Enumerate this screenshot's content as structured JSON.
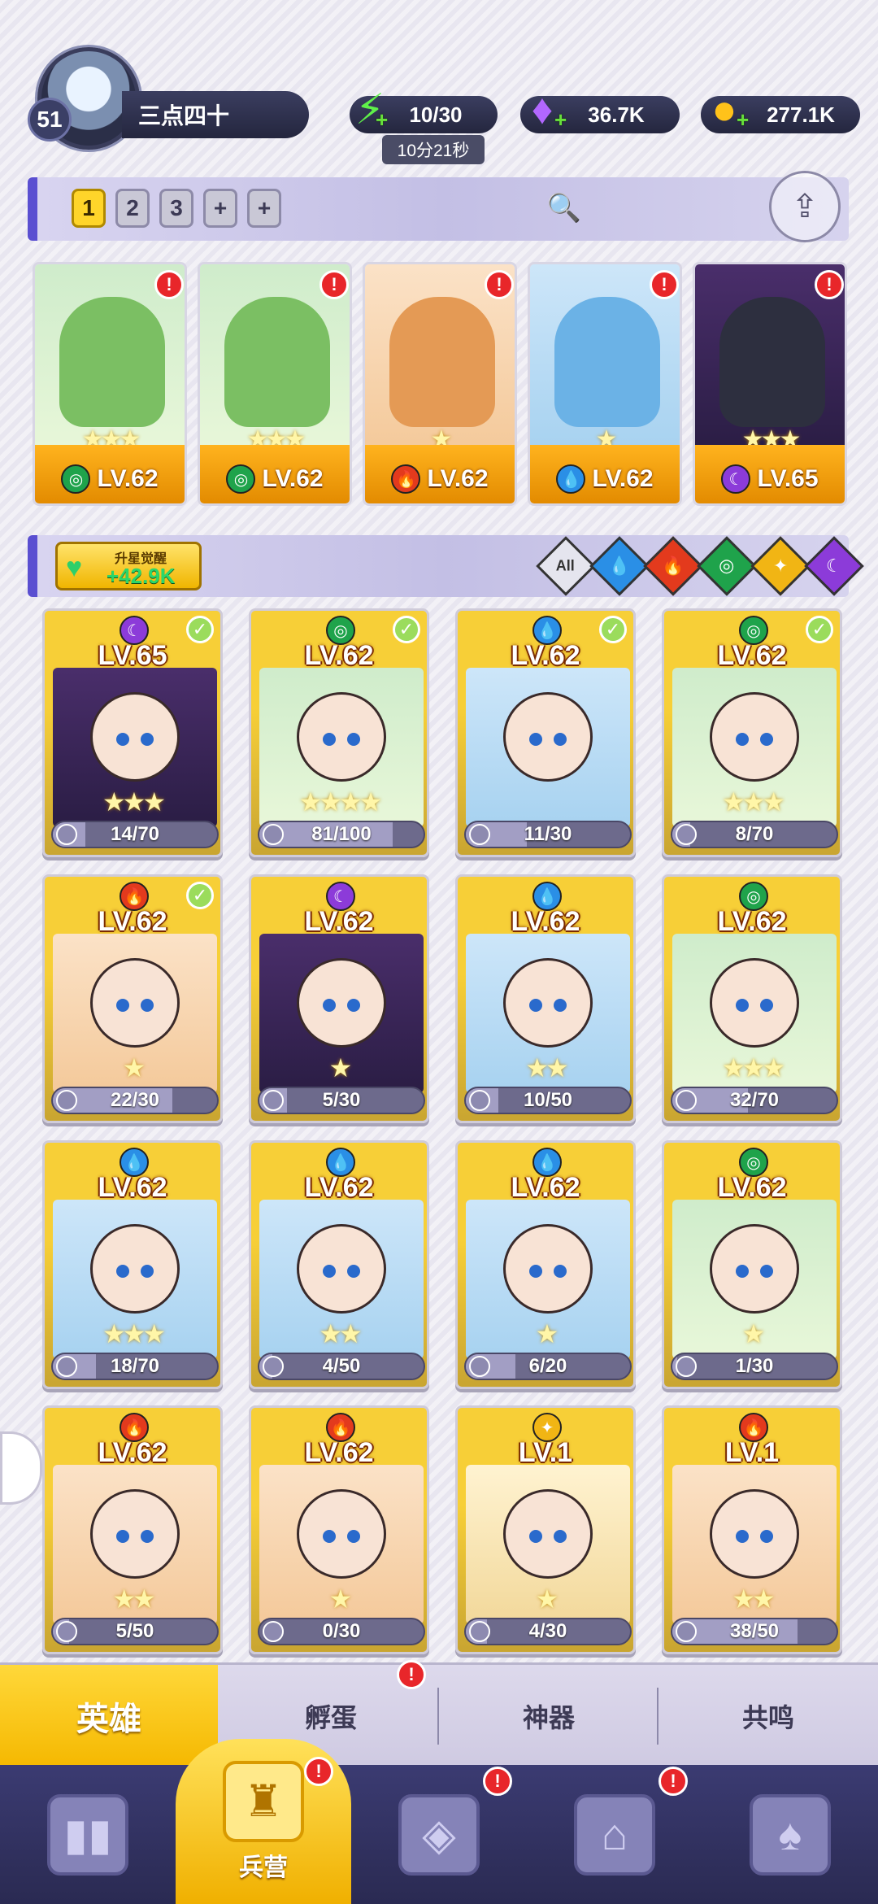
{
  "player": {
    "level": "51",
    "name": "三点四十"
  },
  "resources": {
    "energy": {
      "icon": "lightning-icon",
      "value": "10/30",
      "timer": "10分21秒"
    },
    "gems": {
      "icon": "gem-icon",
      "value": "36.7K"
    },
    "coins": {
      "icon": "coin-icon",
      "value": "277.1K"
    }
  },
  "teams": {
    "slots": [
      "1",
      "2",
      "3",
      "+",
      "+"
    ],
    "active": "1"
  },
  "team_heroes": [
    {
      "level": "LV.62",
      "element": "green",
      "stars": "★★★",
      "alert": "!"
    },
    {
      "level": "LV.62",
      "element": "green",
      "stars": "★★★",
      "alert": "!"
    },
    {
      "level": "LV.62",
      "element": "red",
      "stars": "★",
      "alert": "!"
    },
    {
      "level": "LV.62",
      "element": "blue",
      "stars": "★",
      "alert": "!"
    },
    {
      "level": "LV.65",
      "element": "purple",
      "stars": "★★★",
      "alert": "!"
    }
  ],
  "awaken": {
    "label": "升星觉醒",
    "value": "+42.9K"
  },
  "filters": [
    "All",
    "blue",
    "red",
    "green",
    "gold",
    "purple"
  ],
  "heroes": [
    {
      "level": "LV.65",
      "element": "purple",
      "checked": true,
      "progress": "14/70",
      "fraction": 0.2,
      "stars": "★★★"
    },
    {
      "level": "LV.62",
      "element": "green",
      "checked": true,
      "progress": "81/100",
      "fraction": 0.81,
      "stars": "★★★★"
    },
    {
      "level": "LV.62",
      "element": "blue",
      "checked": true,
      "progress": "11/30",
      "fraction": 0.37,
      "stars": ""
    },
    {
      "level": "LV.62",
      "element": "green",
      "checked": true,
      "progress": "8/70",
      "fraction": 0.11,
      "stars": "★★★"
    },
    {
      "level": "LV.62",
      "element": "red",
      "checked": true,
      "progress": "22/30",
      "fraction": 0.73,
      "stars": "★"
    },
    {
      "level": "LV.62",
      "element": "purple",
      "checked": false,
      "progress": "5/30",
      "fraction": 0.17,
      "stars": "★"
    },
    {
      "level": "LV.62",
      "element": "blue",
      "checked": false,
      "progress": "10/50",
      "fraction": 0.2,
      "stars": "★★"
    },
    {
      "level": "LV.62",
      "element": "green",
      "checked": false,
      "progress": "32/70",
      "fraction": 0.46,
      "stars": "★★★"
    },
    {
      "level": "LV.62",
      "element": "blue",
      "checked": false,
      "progress": "18/70",
      "fraction": 0.26,
      "stars": "★★★"
    },
    {
      "level": "LV.62",
      "element": "blue",
      "checked": false,
      "progress": "4/50",
      "fraction": 0.08,
      "stars": "★★"
    },
    {
      "level": "LV.62",
      "element": "blue",
      "checked": false,
      "progress": "6/20",
      "fraction": 0.3,
      "stars": "★"
    },
    {
      "level": "LV.62",
      "element": "green",
      "checked": false,
      "progress": "1/30",
      "fraction": 0.03,
      "stars": "★"
    },
    {
      "level": "LV.62",
      "element": "red",
      "checked": false,
      "progress": "5/50",
      "fraction": 0.1,
      "stars": "★★"
    },
    {
      "level": "LV.62",
      "element": "red",
      "checked": false,
      "progress": "0/30",
      "fraction": 0.0,
      "stars": "★"
    },
    {
      "level": "LV.1",
      "element": "gold",
      "checked": false,
      "progress": "4/30",
      "fraction": 0.13,
      "stars": "★"
    },
    {
      "level": "LV.1",
      "element": "red",
      "checked": false,
      "progress": "38/50",
      "fraction": 0.76,
      "stars": "★★"
    }
  ],
  "subtabs": [
    {
      "label": "英雄",
      "active": true,
      "alert": ""
    },
    {
      "label": "孵蛋",
      "active": false,
      "alert": "!"
    },
    {
      "label": "神器",
      "active": false,
      "alert": ""
    },
    {
      "label": "共鸣",
      "active": false,
      "alert": ""
    }
  ],
  "bottom_nav": [
    {
      "icon": "cards-icon",
      "label": "",
      "active": false,
      "alert": ""
    },
    {
      "icon": "barracks-icon",
      "label": "兵营",
      "active": true,
      "alert": "!"
    },
    {
      "icon": "map-icon",
      "label": "",
      "active": false,
      "alert": "!"
    },
    {
      "icon": "castle-icon",
      "label": "",
      "active": false,
      "alert": "!"
    },
    {
      "icon": "mushroom-icon",
      "label": "",
      "active": false,
      "alert": ""
    }
  ],
  "colors": {
    "accent": "#5a4fd1",
    "gold": "#f5b800",
    "alert": "#e8262a",
    "green": "#1fa34b",
    "red": "#e33a1d",
    "blue": "#2a8fe6",
    "purple": "#8c3bd9"
  }
}
